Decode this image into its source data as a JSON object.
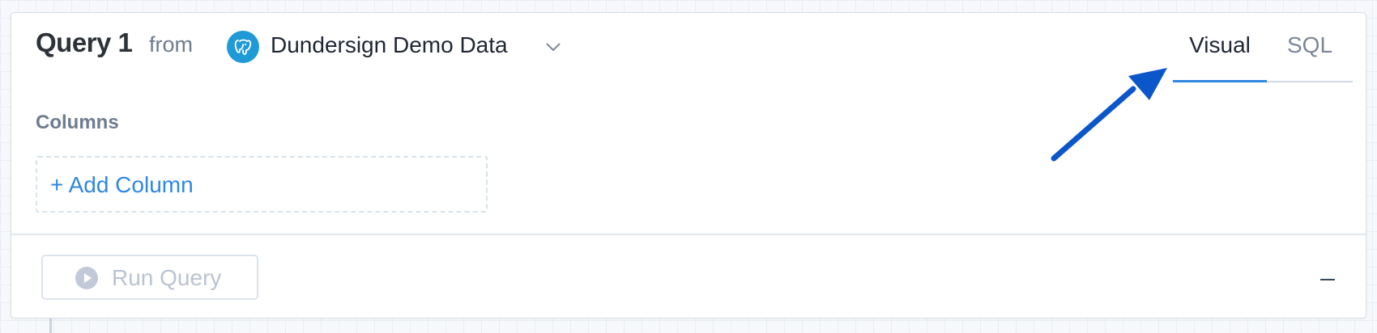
{
  "query": {
    "title": "Query 1",
    "from_label": "from",
    "data_source": "Dundersign Demo Data",
    "data_source_icon": "postgresql-elephant-icon"
  },
  "tabs": [
    {
      "label": "Visual",
      "active": true
    },
    {
      "label": "SQL",
      "active": false
    }
  ],
  "columns": {
    "label": "Columns",
    "add_label": "+ Add Column"
  },
  "footer": {
    "run_label": "Run Query",
    "run_icon": "play-circle-icon",
    "collapse_icon": "minus-icon"
  },
  "colors": {
    "accent": "#2f87e2",
    "arrow": "#0b56c9",
    "datasource_icon_bg": "#1f9ad6"
  }
}
